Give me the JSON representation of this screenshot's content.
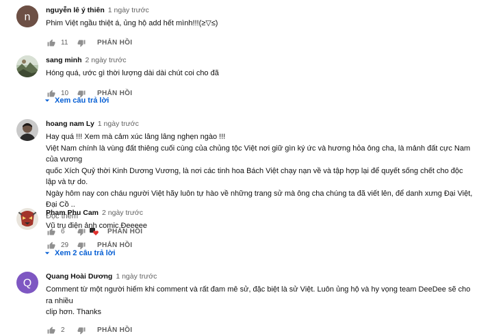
{
  "comments": [
    {
      "author": "nguyễn lê ý thiên",
      "time": "1 ngày trước",
      "avatar_letter": "n",
      "avatar_color": "#6d5045",
      "text_lines": [
        "Phim Việt ngầu thiệt á, ủng hộ add hết mình!!!(≥▽≤)"
      ],
      "likes": "11",
      "reply_label": "PHẢN HỒI"
    },
    {
      "author": "sang minh",
      "time": "2 ngày trước",
      "avatar_icon": "landscape-photo-avatar",
      "text_lines": [
        "Hóng quá, ước gì thời lượng dài dài chút coi cho đã"
      ],
      "likes": "10",
      "reply_label": "PHẢN HỒI",
      "view_replies": "Xem câu trả lời"
    },
    {
      "author": "hoang nam Ly",
      "time": "1 ngày trước",
      "avatar_icon": "person-photo-avatar",
      "text_lines": [
        "Hay quá !!! Xem mà cảm xúc lâng lâng nghẹn ngào !!!",
        "Việt Nam chính là vùng đất thiêng cuối cùng của chủng tộc Việt nơi giữ gìn ký ức và hương hỏa ông cha, là mảnh đất cực Nam của vương",
        "quốc Xích Quỷ thời Kinh Dương Vương, là nơi các tinh hoa Bách Việt chạy nạn về và tập hợp lại để quyết sống chết cho độc lập và tự do.",
        "Ngày hôm nay con cháu người Việt hãy luôn tự hào về những trang sử mà ông cha chúng ta đã viết lên, để danh xưng Đại Việt, Đại Cồ .."
      ],
      "read_more": "Đọc thêm",
      "likes": "6",
      "reply_label": "PHẢN HỒI"
    },
    {
      "author": "Pham Phu Cam",
      "time": "2 ngày trước",
      "avatar_icon": "comic-mask-avatar",
      "text_lines": [
        "Vũ trụ điện ảnh comic Đeeeee"
      ],
      "likes": "29",
      "reply_label": "PHẢN HỒI",
      "view_replies": "Xem 2 câu trả lời"
    },
    {
      "author": "Quang Hoài Dương",
      "time": "1 ngày trước",
      "avatar_letter": "Q",
      "avatar_color": "#7e57c2",
      "text_lines": [
        "Comment từ một người hiếm khi comment và rất đam mê sử, đặc biệt là sử Việt. Luôn ủng hộ và hy vọng team DeeDee sẽ cho ra nhiều",
        "clip hơn. Thanks"
      ],
      "likes": "2",
      "reply_label": "PHẢN HỒI"
    }
  ],
  "colors": {
    "link": "#065fd4",
    "secondary_text": "#606060",
    "heart": "#e0312f"
  }
}
